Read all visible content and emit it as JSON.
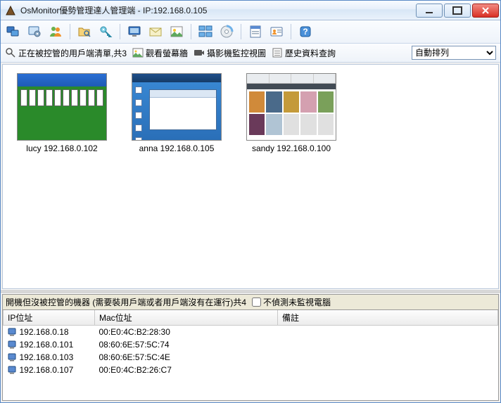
{
  "window": {
    "title": "OsMonitor優勢管理達人管理端 - IP:192.168.0.105"
  },
  "toolbar_icons": [
    "monitor-group-icon",
    "settings-gear-icon",
    "users-icon",
    "sep",
    "folder-search-icon",
    "key-icon",
    "sep",
    "screen-icon",
    "mail-icon",
    "image-icon",
    "sep",
    "screens-multi-icon",
    "disc-icon",
    "sep",
    "form-icon",
    "user-card-icon",
    "sep",
    "help-icon"
  ],
  "infobar": {
    "status_icon": "magnifier-icon",
    "status_text": "正在被控管的用戶端清單,共3",
    "screenwall_icon": "picture-icon",
    "screenwall_text": "觀看螢幕牆",
    "camera_icon": "camera-icon",
    "camera_text": "攝影機監控視圖",
    "history_icon": "history-icon",
    "history_text": "歷史資料查詢",
    "sort_selected": "自動排列"
  },
  "clients": [
    {
      "label": "lucy 192.168.0.102",
      "variant": "green"
    },
    {
      "label": "anna 192.168.0.105",
      "variant": "blue"
    },
    {
      "label": "sandy 192.168.0.100",
      "variant": "gallery"
    }
  ],
  "unmanaged": {
    "heading_prefix": "開機但沒被控管的機器 (需要裝用戶端或者用戶端沒有在運行)共4",
    "checkbox_label": "不偵測未監視電腦",
    "columns": {
      "ip": "IP位址",
      "mac": "Mac位址",
      "note": "備註"
    },
    "rows": [
      {
        "ip": "192.168.0.18",
        "mac": "00:E0:4C:B2:28:30",
        "note": ""
      },
      {
        "ip": "192.168.0.101",
        "mac": "08:60:6E:57:5C:74",
        "note": ""
      },
      {
        "ip": "192.168.0.103",
        "mac": "08:60:6E:57:5C:4E",
        "note": ""
      },
      {
        "ip": "192.168.0.107",
        "mac": "00:E0:4C:B2:26:C7",
        "note": ""
      }
    ]
  }
}
